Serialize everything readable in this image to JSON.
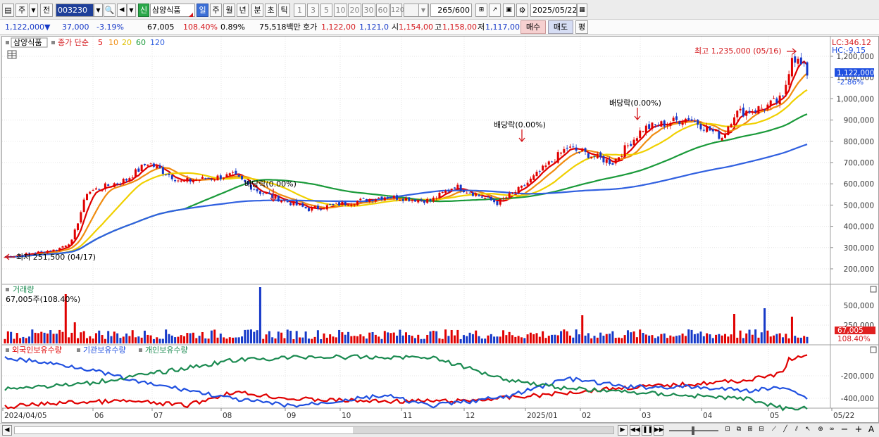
{
  "toolbar": {
    "market": "주",
    "prev": "전",
    "code": "003230",
    "credit_badge": "신",
    "stock_name": "삼양식품",
    "periods": [
      "일",
      "주",
      "월",
      "년",
      "분",
      "초",
      "틱"
    ],
    "selected_period": "일",
    "intervals": [
      "1",
      "3",
      "5",
      "10",
      "20",
      "30",
      "60",
      "120"
    ],
    "count": "265",
    "count_max": "/600",
    "date": "2025/05/22"
  },
  "quote": {
    "price": "1,122,000",
    "direction": "▼",
    "change": "37,000",
    "change_pct": "-3.19%",
    "volume": "67,005",
    "volume_ratio": "108.40%",
    "turnover": "0.89%",
    "amount": "75,518백만",
    "hoga_label": "호가",
    "ask": "1,122,00",
    "bid": "1,121,0",
    "open_label": "시",
    "open": "1,154,00",
    "high_label": "고",
    "high": "1,158,00",
    "low_label": "저",
    "low": "1,117,00",
    "buy_label": "매수",
    "sell_label": "매도",
    "eval_label": "평"
  },
  "legend": {
    "name": "삼양식품",
    "title": "종가 단순",
    "mas": [
      {
        "label": "5",
        "color": "#e00000"
      },
      {
        "label": "10",
        "color": "#f08c10"
      },
      {
        "label": "20",
        "color": "#f0d000"
      },
      {
        "label": "60",
        "color": "#1a9a3a"
      },
      {
        "label": "120",
        "color": "#3060e0"
      }
    ]
  },
  "annotations": {
    "lc": "LC:346.12",
    "hc": "HC:-9.15",
    "high": "최고 1,235,000 (05/16)",
    "low": "최저 251,500 (04/17)",
    "dividend1": "배당락(0.00%)",
    "dividend2": "배당락(0.00%)",
    "dividend3": "배당락(0.00%)",
    "current_price": "1,122,000",
    "current_pct": "-2.86%"
  },
  "volume_panel": {
    "title": "거래량",
    "value": "67,005주(108.40%)",
    "badge": "67,005",
    "badge_pct": "108.40%"
  },
  "holdings_panel": {
    "series": [
      {
        "name": "외국인보유수량",
        "color": "#e00000"
      },
      {
        "name": "기관보유수량",
        "color": "#2050e0"
      },
      {
        "name": "개인보유수량",
        "color": "#1a8a50"
      }
    ]
  },
  "chart_data": {
    "type": "candlestick",
    "price_axis": [
      "1,200,000",
      "1,100,000",
      "1,000,000",
      "900,000",
      "800,000",
      "700,000",
      "600,000",
      "500,000",
      "400,000",
      "300,000",
      "200,000"
    ],
    "volume_axis": [
      "500,000",
      "250,000"
    ],
    "holdings_axis": [
      "-200,000",
      "-400,000"
    ],
    "x_labels": [
      "2024/04/05",
      "06",
      "07",
      "08",
      "09",
      "10",
      "11",
      "12",
      "2025/01",
      "02",
      "03",
      "04",
      "05",
      "05/22"
    ],
    "ylim": [
      150000,
      1250000
    ]
  }
}
